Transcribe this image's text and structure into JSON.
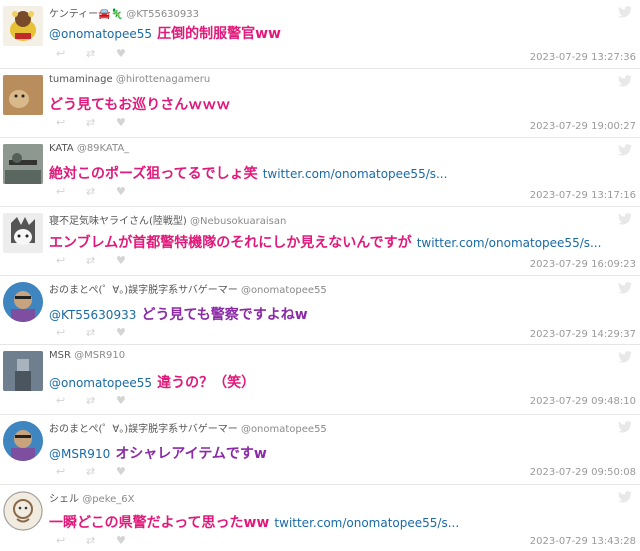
{
  "colors": {
    "pink": "#e0197a",
    "purple": "#8a2aa6",
    "link": "#1a6aa8"
  },
  "tweets": [
    {
      "name": "ケンティー🚘🦎",
      "handle": "@KT55630933",
      "mention": "@onomatopee55",
      "body": "圧倒的制服警官ww",
      "link": "",
      "time": "2023-07-29 13:27:36",
      "color": "#e0197a"
    },
    {
      "name": "tumaminage",
      "handle": "@hirottenagameru",
      "mention": "",
      "body": "どう見てもお巡りさんｗｗｗ",
      "link": "",
      "time": "2023-07-29 19:00:27",
      "color": "#e0197a"
    },
    {
      "name": "KATA",
      "handle": "@89KATA_",
      "mention": "",
      "body": "絶対このポーズ狙ってるでしょ笑",
      "link": "twitter.com/onomatopee55/s...",
      "time": "2023-07-29 13:17:16",
      "color": "#e0197a"
    },
    {
      "name": "寝不足気味ヤライさん(陸戦型)",
      "handle": "@Nebusokuaraisan",
      "mention": "",
      "body": "エンブレムが首都警特機隊のそれにしか見えないんですが",
      "link": "twitter.com/onomatopee55/s...",
      "time": "2023-07-29 16:09:23",
      "color": "#e0197a"
    },
    {
      "name": "おのまとぺ(゜∀。)誤字脱字系サバゲーマー",
      "handle": "@onomatopee55",
      "mention": "@KT55630933",
      "body": "どう見ても警察ですよねw",
      "link": "",
      "time": "2023-07-29 14:29:37",
      "color": "#8a2aa6"
    },
    {
      "name": "MSR",
      "handle": "@MSR910",
      "mention": "@onomatopee55",
      "body": "違うの？（笑）",
      "link": "",
      "time": "2023-07-29 09:48:10",
      "color": "#e0197a"
    },
    {
      "name": "おのまとぺ(゜∀。)誤字脱字系サバゲーマー",
      "handle": "@onomatopee55",
      "mention": "@MSR910",
      "body": "オシャレアイテムですw",
      "link": "",
      "time": "2023-07-29 09:50:08",
      "color": "#8a2aa6"
    },
    {
      "name": "シェル",
      "handle": "@peke_6X",
      "mention": "",
      "body": "一瞬どこの県警だよって思ったww",
      "link": "twitter.com/onomatopee55/s...",
      "time": "2023-07-29 13:43:28",
      "color": "#e0197a"
    }
  ]
}
